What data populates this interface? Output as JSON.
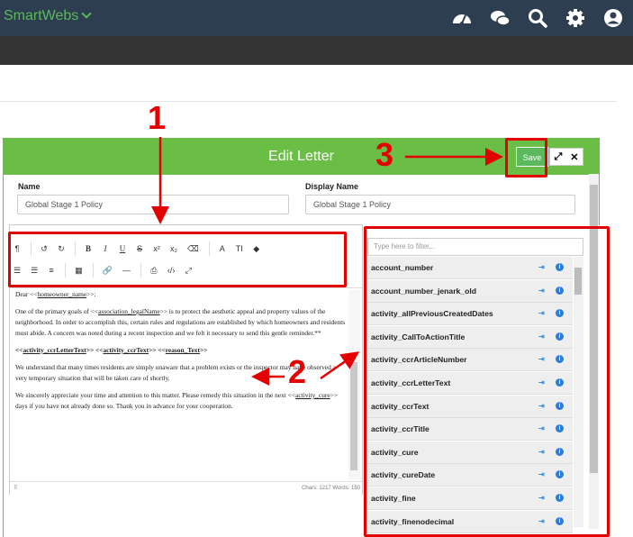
{
  "app": {
    "brand": "SmartWebs"
  },
  "topbar": {
    "icons": [
      "dashboard-icon",
      "chat-icon",
      "search-icon",
      "gear-icon",
      "user-icon"
    ]
  },
  "modal": {
    "title": "Edit Letter",
    "save_label": "Save",
    "name_label": "Name",
    "name_value": "Global Stage 1  Policy",
    "display_name_label": "Display Name",
    "display_name_value": "Global Stage 1 Policy"
  },
  "toolbar": {
    "row1": [
      "¶",
      "↺",
      "↻",
      "B",
      "I",
      "U",
      "S",
      "x²",
      "x₂",
      "⌫",
      "A",
      "TI",
      "◆"
    ],
    "row2": [
      "☰",
      "☰",
      "≡",
      "▦",
      "🔗",
      "—",
      "⎙",
      "‹/›",
      "⤢"
    ]
  },
  "letter": {
    "p1_prefix": "Dear <<",
    "p1_var": "homeowner_name",
    "p1_suffix": ">>:",
    "p2_a": "One of the primary goals of <<",
    "p2_var": "association_legalName",
    "p2_b": ">> is to protect the aesthetic appeal and property values of the neighborhood. In order to accomplish this, certain rules and regulations are established by which homeowners and residents must abide. A concern was noted during a recent inspection and we felt it necessary to send this gentle reminder.**",
    "p3_l1": "<<",
    "p3_v1": "activity_ccrLetterText",
    "p3_m1": ">> <<",
    "p3_v2": "activity_ccrText",
    "p3_m2": ">> <<",
    "p3_v3": "reason_Text",
    "p3_r": ">>",
    "p4": "We understand that many times residents are simply unaware that a problem exists or the inspector may have observed a very temporary situation that will be taken care of shortly.",
    "p5_a": "We sincerely appreciate your time and attention to this matter. Please remedy this situation in the next <<",
    "p5_var": "activity_cure",
    "p5_b": ">> days if you have not already done so. Thank you in advance for your cooperation."
  },
  "status": {
    "counts": "Chars: 1217  Words: 150"
  },
  "fields": {
    "filter_placeholder": "Type here to filter...",
    "items": [
      "account_number",
      "account_number_jenark_old",
      "activity_allPreviousCreatedDates",
      "activity_CallToActionTitle",
      "activity_ccrArticleNumber",
      "activity_ccrLetterText",
      "activity_ccrText",
      "activity_ccrTitle",
      "activity_cure",
      "activity_cureDate",
      "activity_fine",
      "activity_finenodecimal"
    ]
  },
  "annotations": {
    "n1": "1",
    "n2": "2",
    "n3": "3",
    "color": "#e50000"
  },
  "colors": {
    "header_green": "#6abd45",
    "topbar": "#2c3e50",
    "brand": "#5cb85c"
  }
}
